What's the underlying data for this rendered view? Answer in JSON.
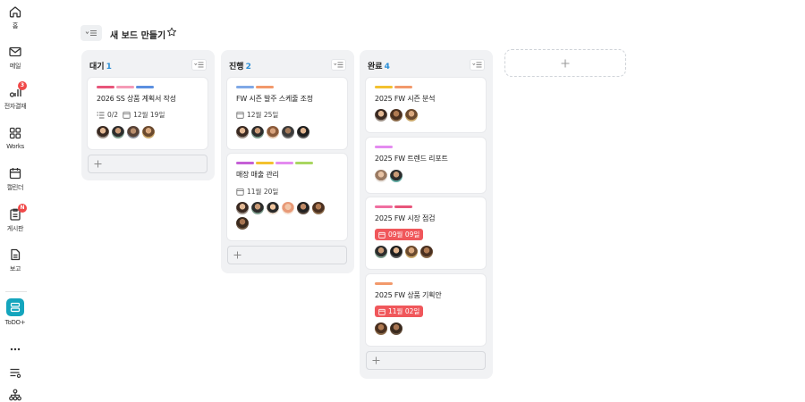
{
  "rail": {
    "items": [
      {
        "label": "홈",
        "icon": "home-icon"
      },
      {
        "label": "메일",
        "icon": "mail-icon"
      },
      {
        "label": "전자결재",
        "icon": "approval-icon",
        "badge": "3"
      },
      {
        "label": "Works",
        "icon": "grid-icon"
      },
      {
        "label": "캘린더",
        "icon": "calendar-icon"
      },
      {
        "label": "게시판",
        "icon": "board-icon",
        "badge": "N"
      },
      {
        "label": "보고",
        "icon": "report-icon"
      },
      {
        "label": "ToDO+",
        "icon": "todo-icon"
      }
    ],
    "more_icon": "more-icon",
    "settings_icon": "list-settings-icon",
    "org_icon": "org-chart-icon"
  },
  "header": {
    "title": "새 보드 만들기",
    "star_icon": "star-icon",
    "toggle_icon": "sidebar-toggle-icon"
  },
  "columns": [
    {
      "name": "대기",
      "count": "1",
      "cards": [
        {
          "title": "2026 SS 상품 계획서 작성",
          "tags": [
            "#e8557a",
            "#f59bb6",
            "#5b8fe0"
          ],
          "checklist": "0/2",
          "date": "12월 19일",
          "avatars": 4
        }
      ]
    },
    {
      "name": "진행",
      "count": "2",
      "cards": [
        {
          "title": "FW 시즌 발주 스케줄 조정",
          "tags": [
            "#7fa8e6",
            "#f2996b"
          ],
          "date": "12월 25일",
          "avatars": 5
        },
        {
          "title": "매장 매출 관리",
          "tags": [
            "#c55fd6",
            "#f3c12f",
            "#e48bf0",
            "#a9d660"
          ],
          "date": "11월 20일",
          "avatars": 7
        }
      ]
    },
    {
      "name": "완료",
      "count": "4",
      "cards": [
        {
          "title": "2025 FW 시즌 분석",
          "tags": [
            "#f3c12f",
            "#f2996b"
          ],
          "avatars": 3
        },
        {
          "title": "2025 FW 트렌드 리포트",
          "tags": [
            "#e48bf0"
          ],
          "avatars": 2
        },
        {
          "title": "2025 FW 시장 점검",
          "tags": [
            "#f06fa0",
            "#e8557a"
          ],
          "due": "09월 09일",
          "avatars": 4
        },
        {
          "title": "2025 FW 상품 기획안",
          "tags": [
            "#f2996b"
          ],
          "due": "11월 02일",
          "avatars": 2
        }
      ]
    }
  ],
  "colors": {
    "accent": "#2b8fd6",
    "due_badge": "#f0575b",
    "todo_tile": "#14a5bd",
    "badge": "#f04949"
  }
}
